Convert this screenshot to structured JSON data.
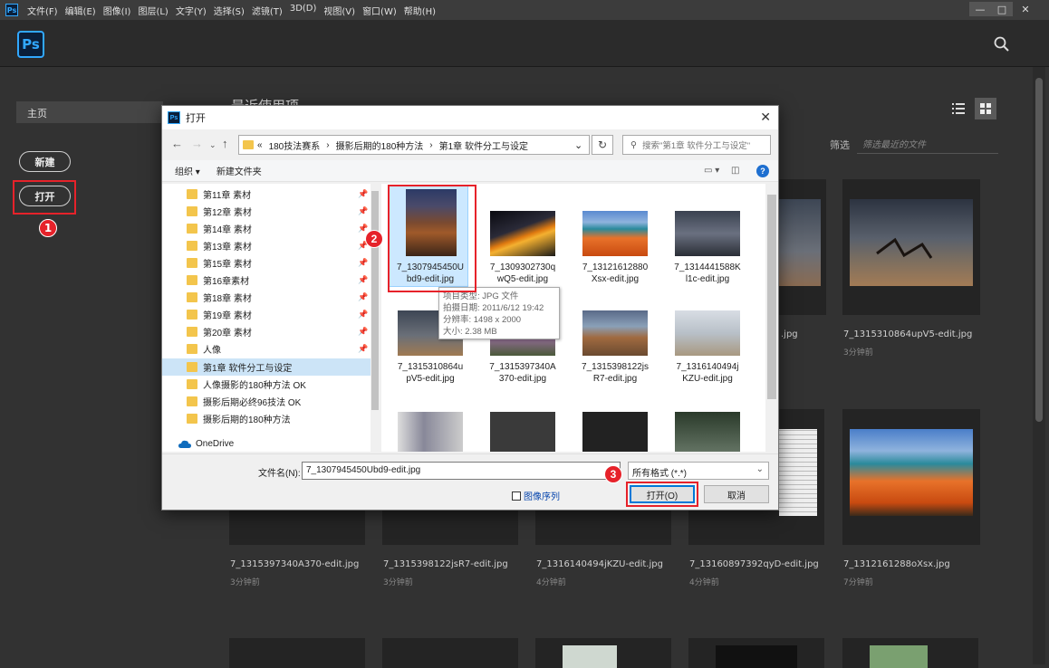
{
  "menubar": {
    "logo": "Ps",
    "items": [
      "文件(F)",
      "编辑(E)",
      "图像(I)",
      "图层(L)",
      "文字(Y)",
      "选择(S)",
      "滤镜(T)",
      "3D(D)",
      "视图(V)",
      "窗口(W)",
      "帮助(H)"
    ],
    "controls": {
      "minimize": "—",
      "maximize": "□",
      "close": "✕"
    }
  },
  "header": {
    "logo": "Ps",
    "search_icon": "search-icon"
  },
  "sidebar": {
    "home": "主页",
    "new_button": "新建",
    "open_button": "打开"
  },
  "main": {
    "section_title": "最近使用项",
    "filter_label": "筛选",
    "filter_placeholder": "筛选最近的文件",
    "recent": [
      {
        "name": "",
        "time": ""
      },
      {
        "name": "",
        "time": ""
      },
      {
        "name": "",
        "time": ""
      },
      {
        "name": "7_1315310864upV5-edit.jpg",
        "time": "3分钟前"
      },
      {
        "name": "7_1315397340A370-edit.jpg",
        "time": "3分钟前"
      },
      {
        "name": "7_1315398122jsR7-edit.jpg",
        "time": "3分钟前"
      },
      {
        "name": "7_1316140494jKZU-edit.jpg",
        "time": "4分钟前"
      },
      {
        "name": "7_13160897392qyD-edit.jpg",
        "time": "4分钟前"
      },
      {
        "name": "7_1312161288oXsx.jpg",
        "time": "7分钟前"
      }
    ],
    "partial_label": ".jpg"
  },
  "callouts": {
    "one": "1",
    "two": "2",
    "three": "3"
  },
  "dialog": {
    "title": "打开",
    "close": "✕",
    "address": {
      "prefix": "«",
      "parts": [
        "180技法赛系",
        "摄影后期的180种方法",
        "第1章 软件分工与设定"
      ],
      "sep": "›"
    },
    "search_placeholder": "搜索\"第1章 软件分工与设定\"",
    "toolbar": {
      "organize": "组织 ▾",
      "new_folder": "新建文件夹"
    },
    "nav": [
      {
        "label": "第11章 素材",
        "pinned": true
      },
      {
        "label": "第12章 素材",
        "pinned": true
      },
      {
        "label": "第14章 素材",
        "pinned": true
      },
      {
        "label": "第13章 素材",
        "pinned": true
      },
      {
        "label": "第15章 素材",
        "pinned": true
      },
      {
        "label": "第16章素材",
        "pinned": true
      },
      {
        "label": "第18章 素材",
        "pinned": true
      },
      {
        "label": "第19章 素材",
        "pinned": true
      },
      {
        "label": "第20章 素材",
        "pinned": true
      },
      {
        "label": "人像",
        "pinned": true
      },
      {
        "label": "第1章 软件分工与设定",
        "pinned": false
      },
      {
        "label": "人像摄影的180种方法 OK",
        "pinned": false
      },
      {
        "label": "摄影后期必终96技法 OK",
        "pinned": false
      },
      {
        "label": "摄影后期的180种方法",
        "pinned": false
      }
    ],
    "onedrive": "OneDrive",
    "files": [
      {
        "l1": "7_1307945450U",
        "l2": "bd9-edit.jpg"
      },
      {
        "l1": "7_1309302730q",
        "l2": "wQ5-edit.jpg"
      },
      {
        "l1": "7_13121612880",
        "l2": "Xsx-edit.jpg"
      },
      {
        "l1": "7_1314441588K",
        "l2": "l1c-edit.jpg"
      },
      {
        "l1": "7_1315310864u",
        "l2": "pV5-edit.jpg"
      },
      {
        "l1": "7_1315397340A",
        "l2": "370-edit.jpg"
      },
      {
        "l1": "7_1315398122js",
        "l2": "R7-edit.jpg"
      },
      {
        "l1": "7_1316140494j",
        "l2": "KZU-edit.jpg"
      }
    ],
    "tooltip": [
      "项目类型: JPG 文件",
      "拍摄日期: 2011/6/12 19:42",
      "分辨率: 1498 x 2000",
      "大小: 2.38 MB"
    ],
    "filename_label": "文件名(N):",
    "filename_value": "7_1307945450Ubd9-edit.jpg",
    "filetype": "所有格式 (*.*)",
    "image_sequence": "图像序列",
    "open_button": "打开(O)",
    "cancel_button": "取消"
  }
}
